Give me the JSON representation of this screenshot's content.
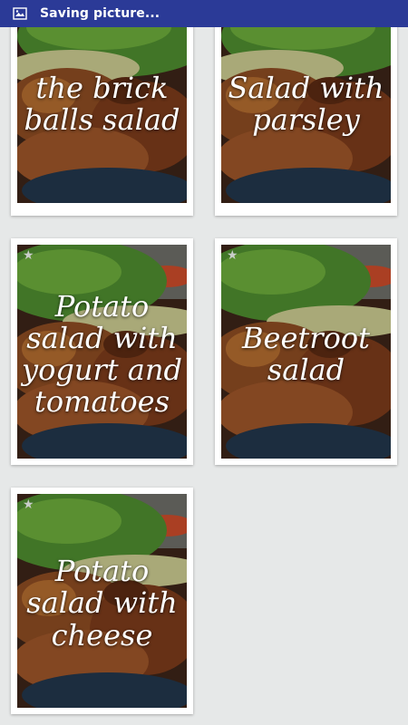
{
  "status_bar": {
    "text": "Saving picture...",
    "icon": "picture-icon",
    "background": "#2b3a97"
  },
  "cards": [
    {
      "title": "the brick balls salad",
      "starred": false
    },
    {
      "title": "Salad with parsley",
      "starred": false
    },
    {
      "title": "Potato salad with yogurt and tomatoes",
      "starred": true
    },
    {
      "title": "Beetroot salad",
      "starred": true
    },
    {
      "title": "Potato salad with cheese",
      "starred": true
    }
  ],
  "colors": {
    "page_background": "#e6e8e8",
    "card_background": "#ffffff",
    "title_text": "#ffffff",
    "star": "#c9cdc9"
  }
}
